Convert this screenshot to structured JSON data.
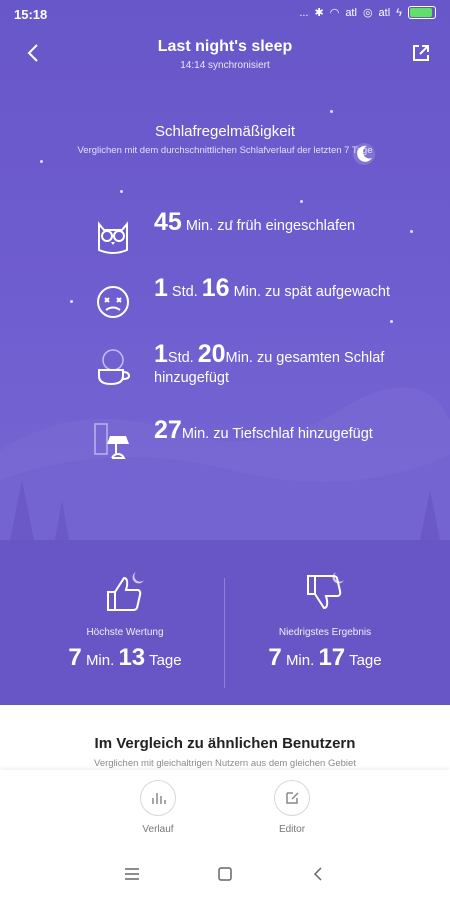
{
  "status": {
    "time": "15:18",
    "signal1": "...",
    "signal2": "atl",
    "signal3": "atl"
  },
  "header": {
    "title": "Last night's sleep",
    "subtitle": "14:14 synchronisiert"
  },
  "regularity": {
    "title": "Schlafregelmäßigkeit",
    "subtitle": "Verglichen mit dem durchschnittlichen Schlafverlauf der letzten 7 Tage"
  },
  "items": [
    {
      "icon": "owl-icon",
      "parts": [
        {
          "t": "45",
          "big": true
        },
        {
          "t": " Min. zu früh eingeschlafen"
        }
      ]
    },
    {
      "icon": "alarm-clock-face-icon",
      "parts": [
        {
          "t": "1",
          "big": true
        },
        {
          "t": " Std. "
        },
        {
          "t": "16",
          "big": true
        },
        {
          "t": " Min. zu spät aufgewacht"
        }
      ]
    },
    {
      "icon": "coffee-cup-icon",
      "parts": [
        {
          "t": "1",
          "big": true
        },
        {
          "t": "Std. "
        },
        {
          "t": "20",
          "big": true
        },
        {
          "t": "Min. zu gesamten Schlaf hinzugefügt"
        }
      ]
    },
    {
      "icon": "lamp-window-icon",
      "parts": [
        {
          "t": "27",
          "big": true
        },
        {
          "t": "Min. zu Tiefschlaf hinzugefügt"
        }
      ]
    }
  ],
  "stats": {
    "best": {
      "label": "Höchste Wertung",
      "min": "7",
      "min_unit": "Min.",
      "days": "13",
      "days_unit": "Tage"
    },
    "worst": {
      "label": "Niedrigstes Ergebnis",
      "min": "7",
      "min_unit": "Min.",
      "days": "17",
      "days_unit": "Tage"
    }
  },
  "compare": {
    "title": "Im Vergleich zu ähnlichen Benutzern",
    "subtitle": "Verglichen mit gleichaltrigen Nutzern aus dem gleichen Gebiet"
  },
  "tabs": [
    {
      "label": "Verlauf",
      "icon": "bar-chart-icon"
    },
    {
      "label": "Editor",
      "icon": "edit-icon"
    }
  ],
  "colors": {
    "background": "#6857c9",
    "battery": "#5ee06b"
  }
}
